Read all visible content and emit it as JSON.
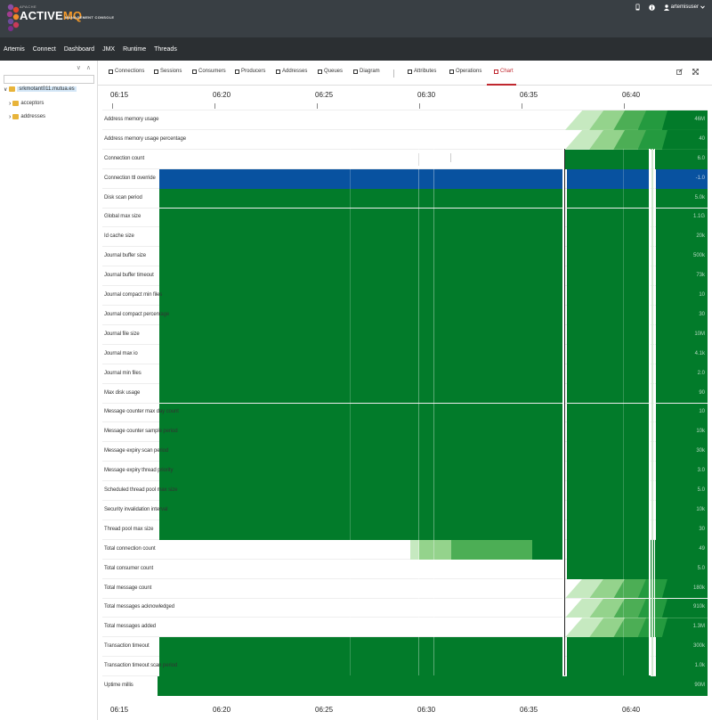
{
  "header": {
    "logo_small": "APACHE",
    "logo_word_a": "ACTIVE",
    "logo_word_b": "MQ",
    "logo_sub": "MANAGEMENT CONSOLE",
    "username": "artemisuser",
    "icons": [
      "mobile-icon",
      "info-icon",
      "user-icon"
    ]
  },
  "nav": [
    "Artemis",
    "Connect",
    "Dashboard",
    "JMX",
    "Runtime",
    "Threads"
  ],
  "tree": {
    "root": "srkmotant011.mutua.es",
    "children": [
      "acceptors",
      "addresses"
    ]
  },
  "tabs": [
    "Connections",
    "Sessions",
    "Consumers",
    "Producers",
    "Addresses",
    "Queues",
    "Diagram",
    "Attributes",
    "Operations",
    "Chart"
  ],
  "tab_icons": [
    "chart-icon",
    "list-icon",
    "consumers-icon",
    "producers-icon",
    "bookmark-icon",
    "list-icon",
    "diagram-icon",
    "list-icon",
    "operations-icon",
    "chart-icon"
  ],
  "active_tab": "Chart",
  "tab_actions": [
    "edit-icon",
    "expand-icon"
  ],
  "axis": {
    "times": [
      "06:15",
      "06:20",
      "06:25",
      "06:30",
      "06:35",
      "06:40"
    ]
  },
  "colors": {
    "green": "#027b2a",
    "blue": "#0852a0",
    "light1": "#c6e9c0",
    "light2": "#94d38c",
    "light3": "#4cae55",
    "light4": "#249a3f"
  },
  "chart_data": {
    "type": "heatmap",
    "x_times": [
      "06:15",
      "06:20",
      "06:25",
      "06:30",
      "06:35",
      "06:40"
    ],
    "rows": [
      {
        "label": "Address memory usage",
        "value": "46M"
      },
      {
        "label": "Address memory usage percentage",
        "value": "40"
      },
      {
        "label": "Connection count",
        "value": "6.0"
      },
      {
        "label": "Connection ttl override",
        "value": "-1.0"
      },
      {
        "label": "Disk scan period",
        "value": "5.0k"
      },
      {
        "label": "Global max size",
        "value": "1.1G"
      },
      {
        "label": "Id cache size",
        "value": "20k"
      },
      {
        "label": "Journal buffer size",
        "value": "500k"
      },
      {
        "label": "Journal buffer timeout",
        "value": "73k"
      },
      {
        "label": "Journal compact min files",
        "value": "10"
      },
      {
        "label": "Journal compact percentage",
        "value": "30"
      },
      {
        "label": "Journal file size",
        "value": "10M"
      },
      {
        "label": "Journal max io",
        "value": "4.1k"
      },
      {
        "label": "Journal min files",
        "value": "2.0"
      },
      {
        "label": "Max disk usage",
        "value": "90"
      },
      {
        "label": "Message counter max day count",
        "value": "10"
      },
      {
        "label": "Message counter sample period",
        "value": "10k"
      },
      {
        "label": "Message expiry scan period",
        "value": "30k"
      },
      {
        "label": "Message expiry thread priority",
        "value": "3.0"
      },
      {
        "label": "Scheduled thread pool max size",
        "value": "5.0"
      },
      {
        "label": "Security invalidation interval",
        "value": "10k"
      },
      {
        "label": "Thread pool max size",
        "value": "30"
      },
      {
        "label": "Total connection count",
        "value": "49"
      },
      {
        "label": "Total consumer count",
        "value": "5.0"
      },
      {
        "label": "Total message count",
        "value": "180k"
      },
      {
        "label": "Total messages acknowledged",
        "value": "910k"
      },
      {
        "label": "Total messages added",
        "value": "1.3M"
      },
      {
        "label": "Transaction timeout",
        "value": "300k"
      },
      {
        "label": "Transaction timeout scan period",
        "value": "1.0k"
      },
      {
        "label": "Uptime millis",
        "value": "90M"
      }
    ]
  }
}
